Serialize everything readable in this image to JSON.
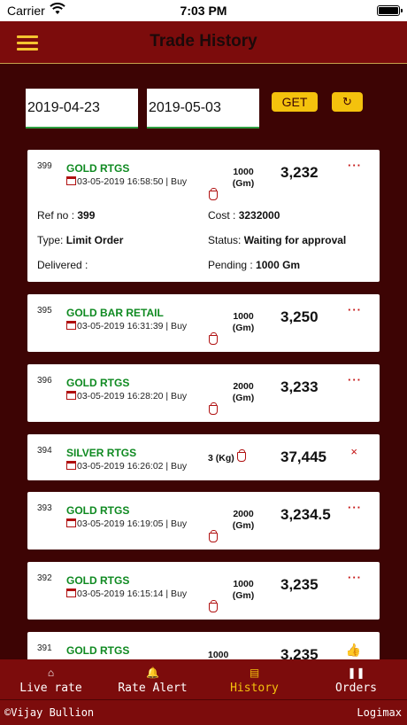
{
  "status_bar": {
    "carrier": "Carrier",
    "time": "7:03 PM"
  },
  "header": {
    "title": "Trade History"
  },
  "filter": {
    "from_date": "2019-04-23",
    "to_date": "2019-05-03",
    "get_label": "GET",
    "refresh_icon": "↻"
  },
  "trades": [
    {
      "id": "399",
      "product": "GOLD RTGS",
      "datetime": "03-05-2019 16:58:50 | Buy",
      "qty": "1000",
      "unit": "(Gm)",
      "price": "3,232",
      "action_icon": "more-dots-icon",
      "action": "···",
      "details": {
        "ref_label": "Ref no : ",
        "ref": "399",
        "cost_label": "Cost : ",
        "cost": "3232000",
        "type_label": "Type: ",
        "type": "Limit Order",
        "status_label": "Status: ",
        "status": "Waiting for approval",
        "delivered_label": "Delivered :",
        "pending_label": "Pending : ",
        "pending": "1000 Gm"
      }
    },
    {
      "id": "395",
      "product": "GOLD BAR RETAIL",
      "datetime": "03-05-2019 16:31:39 | Buy",
      "qty": "1000",
      "unit": "(Gm)",
      "price": "3,250",
      "action_icon": "more-dots-icon",
      "action": "···"
    },
    {
      "id": "396",
      "product": "GOLD RTGS",
      "datetime": "03-05-2019 16:28:20 | Buy",
      "qty": "2000",
      "unit": "(Gm)",
      "price": "3,233",
      "action_icon": "more-dots-icon",
      "action": "···"
    },
    {
      "id": "394",
      "product": "SILVER RTGS",
      "datetime": "03-05-2019 16:26:02 | Buy",
      "qty": "3 (Kg)",
      "unit": "",
      "price": "37,445",
      "action_icon": "close-icon",
      "action": "×"
    },
    {
      "id": "393",
      "product": "GOLD RTGS",
      "datetime": "03-05-2019 16:19:05 | Buy",
      "qty": "2000",
      "unit": "(Gm)",
      "price": "3,234.5",
      "action_icon": "more-dots-icon",
      "action": "···"
    },
    {
      "id": "392",
      "product": "GOLD RTGS",
      "datetime": "03-05-2019 16:15:14 | Buy",
      "qty": "1000",
      "unit": "(Gm)",
      "price": "3,235",
      "action_icon": "more-dots-icon",
      "action": "···"
    },
    {
      "id": "391",
      "product": "GOLD RTGS",
      "datetime": "",
      "qty": "1000",
      "unit": "",
      "price": "3,235",
      "action_icon": "thumbs-up-icon",
      "action": "👍"
    }
  ],
  "nav": [
    {
      "label": "Live rate",
      "icon": "home-icon",
      "glyph": "⌂"
    },
    {
      "label": "Rate Alert",
      "icon": "bell-icon",
      "glyph": "🔔"
    },
    {
      "label": "History",
      "icon": "history-icon",
      "glyph": "▤"
    },
    {
      "label": "Orders",
      "icon": "pause-icon",
      "glyph": "❚❚"
    }
  ],
  "footer": {
    "copyright": "©Vijay Bullion",
    "powered": "Logimax"
  },
  "colors": {
    "header": "#7c0c0c",
    "background": "#3d0404",
    "accent": "#f4c20d",
    "product_green": "#0f8a21",
    "action_red": "#c41212"
  }
}
